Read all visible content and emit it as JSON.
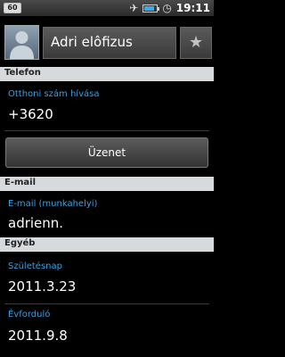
{
  "status": {
    "notification": "60",
    "time": "19:11"
  },
  "contact": {
    "name": "Adri elôfizus"
  },
  "sections": {
    "phone": "Telefon",
    "email": "E-mail",
    "other": "Egyéb"
  },
  "phone": {
    "label": "Otthoni szám hívása",
    "value": "+3620",
    "message_button": "Üzenet"
  },
  "email": {
    "label": "E-mail (munkahelyi)",
    "value": "adrienn."
  },
  "other": {
    "birthday_label": "Születésnap",
    "birthday_value": "2011.3.23",
    "anniversary_label": "Évforduló",
    "anniversary_value": "2011.9.8"
  },
  "icons": [
    "notification-icon",
    "airplane-icon",
    "battery-icon",
    "alarm-icon",
    "avatar-icon",
    "star-icon"
  ],
  "colors": {
    "label_blue": "#3ca0e0",
    "section_bg": "#d7dadd",
    "battery_blue": "#3fa9e8"
  }
}
